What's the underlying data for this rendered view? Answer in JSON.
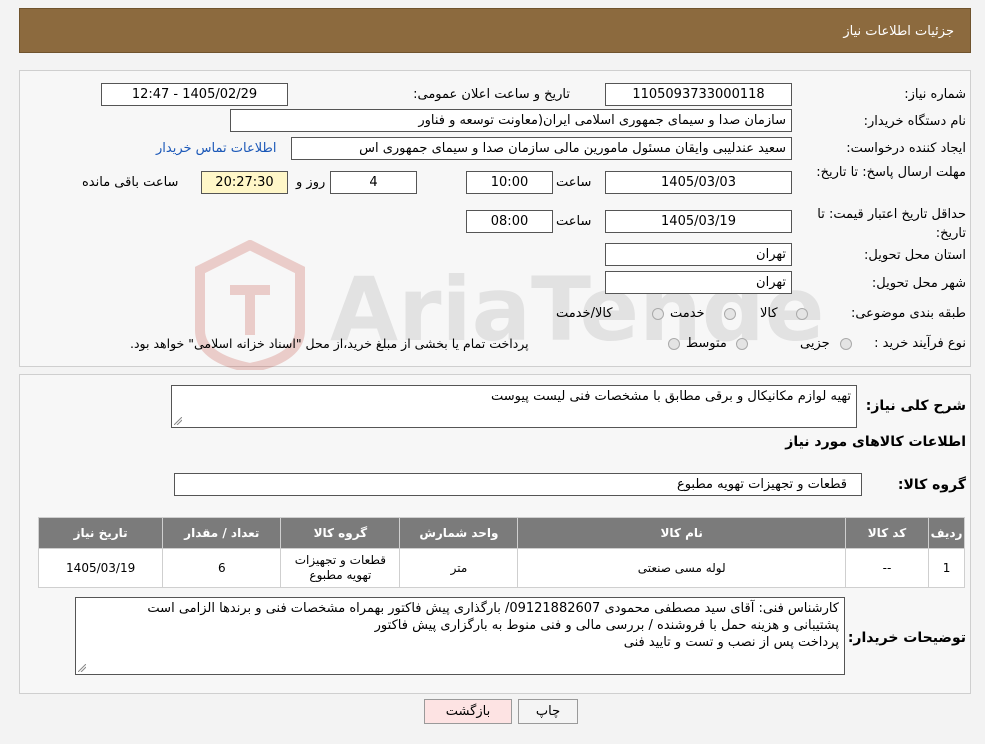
{
  "header": {
    "title": "جزئیات اطلاعات نیاز"
  },
  "form": {
    "need_number_label": "شماره نیاز:",
    "need_number": "1105093733000118",
    "announce_label": "تاریخ و ساعت اعلان عمومی:",
    "announce_value": "1405/02/29 - 12:47",
    "buyer_label": "نام دستگاه خریدار:",
    "buyer_value": "سازمان صدا و سیمای جمهوری اسلامی ایران(معاونت توسعه و فناور",
    "creator_label": "ایجاد کننده درخواست:",
    "creator_value": "سعید عندلیبی وایقان مسئول مامورین مالی  سازمان صدا و سیمای جمهوری اس",
    "contact_link": "اطلاعات تماس خریدار",
    "deadline_label": "مهلت ارسال پاسخ: تا تاریخ:",
    "deadline_date": "1405/03/03",
    "time_word": "ساعت",
    "deadline_time": "10:00",
    "days_value": "4",
    "days_word": "روز و",
    "remaining_time": "20:27:30",
    "remaining_label": "ساعت باقی مانده",
    "validity_label": "حداقل تاریخ اعتبار قیمت: تا تاریخ:",
    "validity_date": "1405/03/19",
    "validity_time": "08:00",
    "province_label": "استان محل تحویل:",
    "province_value": "تهران",
    "city_label": "شهر محل تحویل:",
    "city_value": "تهران",
    "category_label": "طبقه بندی موضوعی:",
    "category_options": [
      "کالا",
      "خدمت",
      "کالا/خدمت"
    ],
    "process_label": "نوع فرآیند خرید :",
    "process_options": [
      "جزیی",
      "متوسط"
    ],
    "process_note": "پرداخت تمام یا بخشی از مبلغ خرید،از محل \"اسناد خزانه اسلامی\" خواهد بود."
  },
  "summary": {
    "desc_label": "شرح کلی نیاز:",
    "desc_value": "تهیه لوازم مکانیکال و برقی مطابق با مشخصات فنی لیست پیوست",
    "goods_info_title": "اطلاعات کالاهای مورد نیاز",
    "group_label": "گروه کالا:",
    "group_value": "قطعات و تجهیزات تهویه مطبوع"
  },
  "table": {
    "headers": [
      "ردیف",
      "کد کالا",
      "نام کالا",
      "واحد شمارش",
      "گروه کالا",
      "تعداد / مقدار",
      "تاریخ نیاز"
    ],
    "row": [
      "1",
      "--",
      "لوله مسی صنعتی",
      "متر",
      "قطعات و تجهیزات تهویه مطبوع",
      "6",
      "1405/03/19"
    ]
  },
  "buyer_notes": {
    "label": "توضیحات خریدار:",
    "lines": [
      "کارشناس فنی: آقای سید مصطفی محمودی 09121882607/ بارگذاری پیش فاکتور بهمراه مشخصات فنی و برندها الزامی است",
      "پشتیبانی و هزینه حمل با فروشنده / بررسی مالی و فنی منوط به بارگزاری پیش فاکتور",
      "پرداخت پس از نصب و تست و تایید فنی"
    ]
  },
  "buttons": {
    "print": "چاپ",
    "back": "بازگشت"
  },
  "watermark": {
    "text": "AriaTender.neT"
  },
  "colors": {
    "header": "#8c6a3e",
    "table_header": "#7b7b7b",
    "link": "#1b58b8",
    "back_button": "#fde3e3"
  }
}
